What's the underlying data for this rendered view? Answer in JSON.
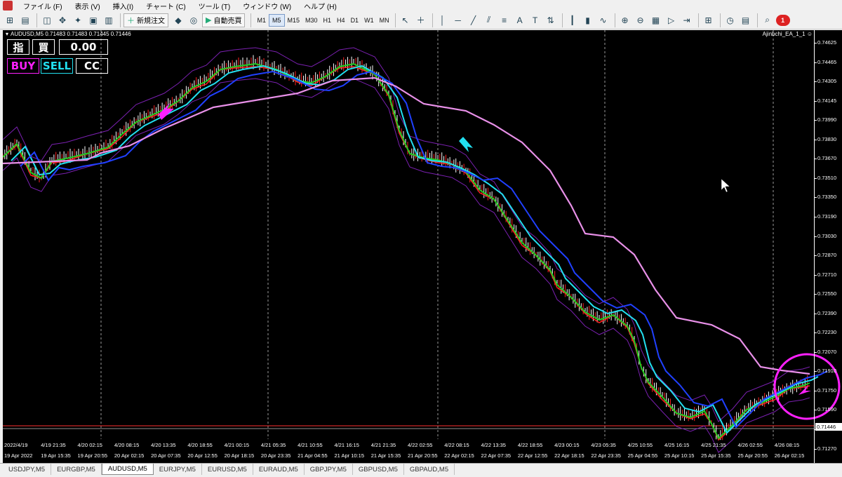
{
  "menu": [
    "ファイル (F)",
    "表示 (V)",
    "挿入(I)",
    "チャート (C)",
    "ツール (T)",
    "ウィンドウ (W)",
    "ヘルプ (H)"
  ],
  "toolbar": {
    "new_order_label": "新規注文",
    "auto_trade_label": "自動売買",
    "timeframes": [
      "M1",
      "M5",
      "M15",
      "M30",
      "H1",
      "H4",
      "D1",
      "W1",
      "MN"
    ],
    "active_timeframe": "M5",
    "alert_badge": "1"
  },
  "chart": {
    "header": "AUDUSD,M5  0.71483 0.71483 0.71445 0.71446",
    "ea_name": "Ajinbchi_EA_1_1",
    "panel": {
      "sashi": "指",
      "kai": "買",
      "value": "0.00",
      "buy": "BUY",
      "sell": "SELL",
      "cc": "CC"
    },
    "current_price": "0.71446",
    "price_labels": [
      "0.74625",
      "0.74465",
      "0.74305",
      "0.74145",
      "0.73990",
      "0.73830",
      "0.73670",
      "0.73510",
      "0.73350",
      "0.73190",
      "0.73030",
      "0.72870",
      "0.72710",
      "0.72550",
      "0.72390",
      "0.72230",
      "0.72070",
      "0.71910",
      "0.71750",
      "0.71590",
      "0.71430",
      "0.71270"
    ],
    "time_labels": [
      "19 Apr 2022",
      "19 Apr 15:35",
      "19 Apr 20:55",
      "20 Apr 02:15",
      "20 Apr 07:35",
      "20 Apr 12:55",
      "20 Apr 18:15",
      "20 Apr 23:35",
      "21 Apr 04:55",
      "21 Apr 10:15",
      "21 Apr 15:35",
      "21 Apr 20:55",
      "22 Apr 02:15",
      "22 Apr 07:35",
      "22 Apr 12:55",
      "22 Apr 18:15",
      "22 Apr 23:35",
      "25 Apr 04:55",
      "25 Apr 10:15",
      "25 Apr 15:35",
      "25 Apr 20:55",
      "26 Apr 02:15"
    ],
    "session_labels": [
      "2022/4/19",
      "4/19 21:35",
      "4/20 02:15",
      "4/20 08:15",
      "4/20 13:35",
      "4/20 18:55",
      "4/21 00:15",
      "4/21 05:35",
      "4/21 10:55",
      "4/21 16:15",
      "4/21 21:35",
      "4/22 02:55",
      "4/22 08:15",
      "4/22 13:35",
      "4/22 18:55",
      "4/23 00:15",
      "4/23 05:35",
      "4/25 10:55",
      "4/25 16:15",
      "4/25 21:35",
      "4/26 02:55",
      "4/26 08:15"
    ],
    "colors": {
      "bg": "#000000",
      "candle_bull": "#ffffff",
      "candle_bear": "#ff2020",
      "ma_fast": "#ff2020",
      "ma_green": "#22cc22",
      "ma_cyan": "#22e0f0",
      "ma_blue": "#2040ff",
      "envelope": "#7a20b0",
      "long_line": "#e890e8",
      "arrow_buy": "#ff20ff",
      "arrow_sell": "#22e0f0",
      "circle": "#ff20ff",
      "price_line": "#ff3030"
    }
  },
  "tabs": [
    "USDJPY,M5",
    "EURGBP,M5",
    "AUDUSD,M5",
    "EURJPY,M5",
    "EURUSD,M5",
    "EURAUD,M5",
    "GBPJPY,M5",
    "GBPUSD,M5",
    "GBPAUD,M5"
  ],
  "active_tab": "AUDUSD,M5"
}
